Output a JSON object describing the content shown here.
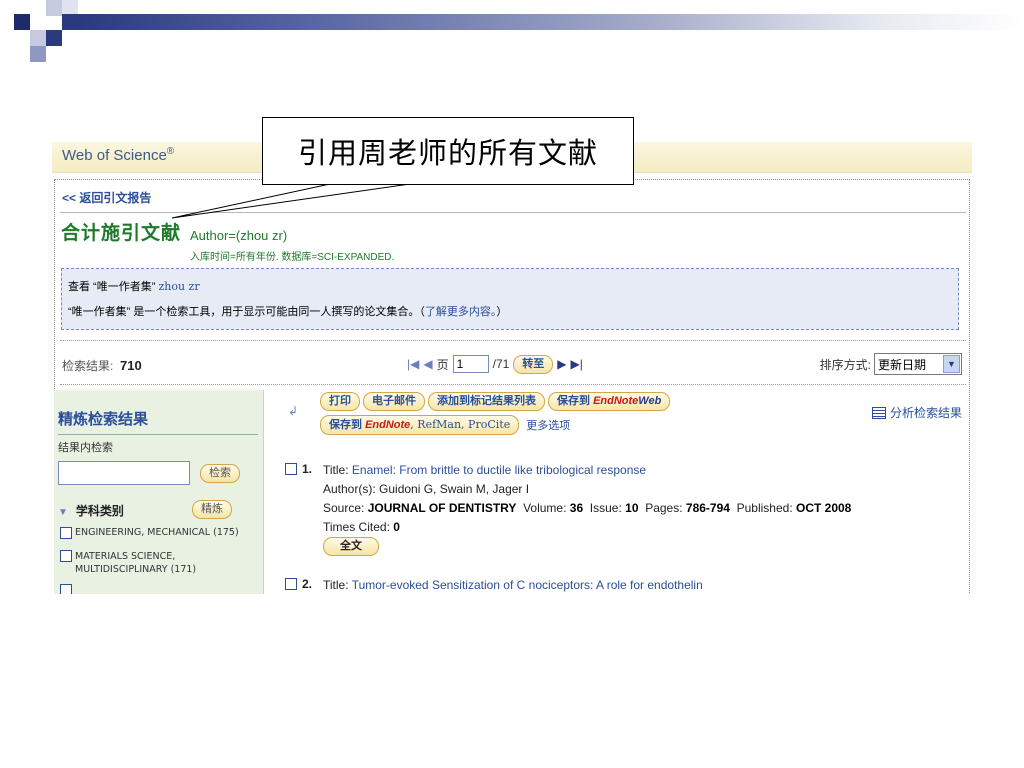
{
  "header": {
    "logo_text": "Web of Science",
    "logo_mark": "®"
  },
  "nav": {
    "back_link": "<< 返回引文报告"
  },
  "page": {
    "title": "合计施引文献",
    "author_query": "Author=(zhou zr)",
    "time_info": "入库时间=所有年份. 数据库=SCI-EXPANDED."
  },
  "info_box": {
    "line1_prefix": "查看 “唯一作者集”",
    "line1_link": "zhou zr",
    "line2_prefix": "“唯一作者集” 是一个检索工具，用于显示可能由同一人撰写的论文集合。（",
    "line2_link": "了解更多内容。",
    "line2_suffix": "）"
  },
  "results": {
    "label": "检索结果:",
    "count": "710"
  },
  "pager": {
    "page_label": "页",
    "current_page": "1",
    "total": "/71",
    "go_button": "转至"
  },
  "sort": {
    "label": "排序方式:",
    "selected": "更新日期"
  },
  "refine": {
    "title": "精炼检索结果",
    "within_label": "结果内检索",
    "search_button": "检索",
    "category_label": "学科类别",
    "category_button": "精炼",
    "items": [
      {
        "label": "ENGINEERING, MECHANICAL (175)"
      },
      {
        "label": "MATERIALS SCIENCE, MULTIDISCIPLINARY (171)"
      }
    ]
  },
  "actions": {
    "print": "打印",
    "email": "电子邮件",
    "add_marked": "添加到标记结果列表",
    "save_to": "保存到",
    "endnote": "EndNote",
    "web": "Web",
    "save_to2": "保存到",
    "endnote2": "EndNote",
    "refman": ", RefMan, ProCite",
    "more_options": "更多选项",
    "analyze": "分析检索结果"
  },
  "records": [
    {
      "num": "1.",
      "title_label": "Title:",
      "title": "Enamel: From brittle to ductile like tribological response",
      "authors": "Author(s): Guidoni G, Swain M, Jager I",
      "source_label": "Source:",
      "source": "JOURNAL OF DENTISTRY",
      "volume_label": "Volume:",
      "volume": "36",
      "issue_label": "Issue:",
      "issue": "10",
      "pages_label": "Pages:",
      "pages": "786-794",
      "published_label": "Published:",
      "published": "OCT 2008",
      "cited_label": "Times Cited:",
      "cited": "0",
      "fulltext_button": "全文"
    },
    {
      "num": "2.",
      "title_label": "Title:",
      "title": "Tumor-evoked Sensitization of C nociceptors: A role for endothelin"
    }
  ],
  "callout": {
    "text": "引用周老师的所有文献"
  }
}
